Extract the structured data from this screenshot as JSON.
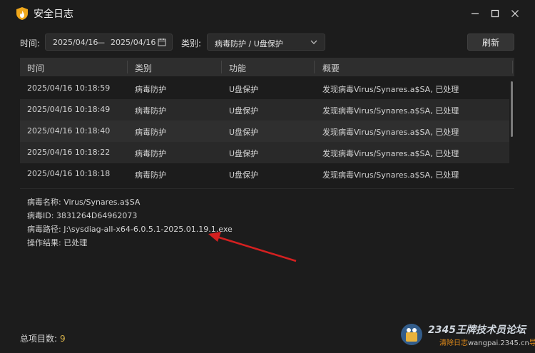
{
  "window": {
    "title": "安全日志",
    "min_symbol": "—",
    "max_symbol": "☐",
    "close_symbol": "✕"
  },
  "filters": {
    "time_label": "时间:",
    "date_from": "2025/04/16",
    "date_sep": "—",
    "date_to": "2025/04/16",
    "category_label": "类别:",
    "category_value": "病毒防护 / U盘保护",
    "refresh_label": "刷新"
  },
  "table": {
    "columns": [
      "时间",
      "类别",
      "功能",
      "概要"
    ],
    "rows": [
      [
        "2025/04/16 10:18:59",
        "病毒防护",
        "U盘保护",
        "发现病毒Virus/Synares.a$SA, 已处理"
      ],
      [
        "2025/04/16 10:18:49",
        "病毒防护",
        "U盘保护",
        "发现病毒Virus/Synares.a$SA, 已处理"
      ],
      [
        "2025/04/16 10:18:40",
        "病毒防护",
        "U盘保护",
        "发现病毒Virus/Synares.a$SA, 已处理"
      ],
      [
        "2025/04/16 10:18:22",
        "病毒防护",
        "U盘保护",
        "发现病毒Virus/Synares.a$SA, 已处理"
      ],
      [
        "2025/04/16 10:18:18",
        "病毒防护",
        "U盘保护",
        "发现病毒Virus/Synares.a$SA, 已处理"
      ]
    ]
  },
  "detail": {
    "virus_name": "病毒名称: Virus/Synares.a$SA",
    "virus_id": "病毒ID: 3831264D64962073",
    "virus_path": "病毒路径: J:\\sysdiag-all-x64-6.0.5.1-2025.01.19.1.exe",
    "result": "操作结果: 已处理"
  },
  "footer": {
    "total_label": "总项目数:",
    "total_count": "9"
  },
  "watermark": {
    "line1": "2345王牌技术员论坛",
    "line2a": "清除日志",
    "line2b": "wangpai.2345.cn",
    "line2c": "导出日志"
  },
  "colors": {
    "background": "#1c1c1c",
    "accent_count": "#d7b24a",
    "arrow": "#d42020"
  }
}
